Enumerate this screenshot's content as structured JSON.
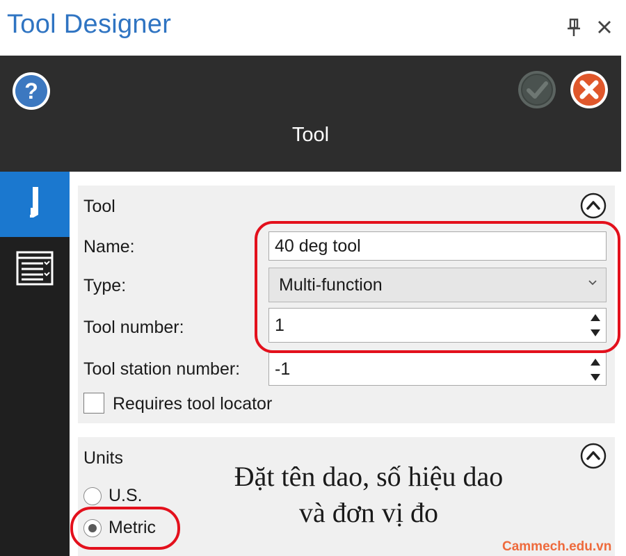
{
  "window": {
    "title": "Tool Designer"
  },
  "header": {
    "title": "Tool"
  },
  "sidebar": {
    "tabs": [
      {
        "icon": "tool-icon",
        "active": true
      },
      {
        "icon": "list-settings-icon",
        "active": false
      }
    ]
  },
  "tool_section": {
    "heading": "Tool",
    "name_label": "Name:",
    "name_value": "40 deg tool",
    "type_label": "Type:",
    "type_value": "Multi-function",
    "tool_number_label": "Tool number:",
    "tool_number_value": "1",
    "station_label": "Tool station number:",
    "station_value": "-1",
    "requires_locator_label": "Requires tool locator",
    "requires_locator_checked": false
  },
  "units_section": {
    "heading": "Units",
    "options": [
      {
        "label": "U.S.",
        "selected": false
      },
      {
        "label": "Metric",
        "selected": true
      }
    ]
  },
  "annotation": {
    "line1": "Đặt tên dao, số hiệu dao",
    "line2": "và đơn vị đo"
  },
  "watermark": "Cammech.edu.vn",
  "colors": {
    "title_blue": "#2f74c2",
    "header_dark": "#2d2d2d",
    "active_tab_blue": "#1b78cf",
    "highlight_red": "#e3101c",
    "watermark_orange": "#ee6a3c"
  }
}
